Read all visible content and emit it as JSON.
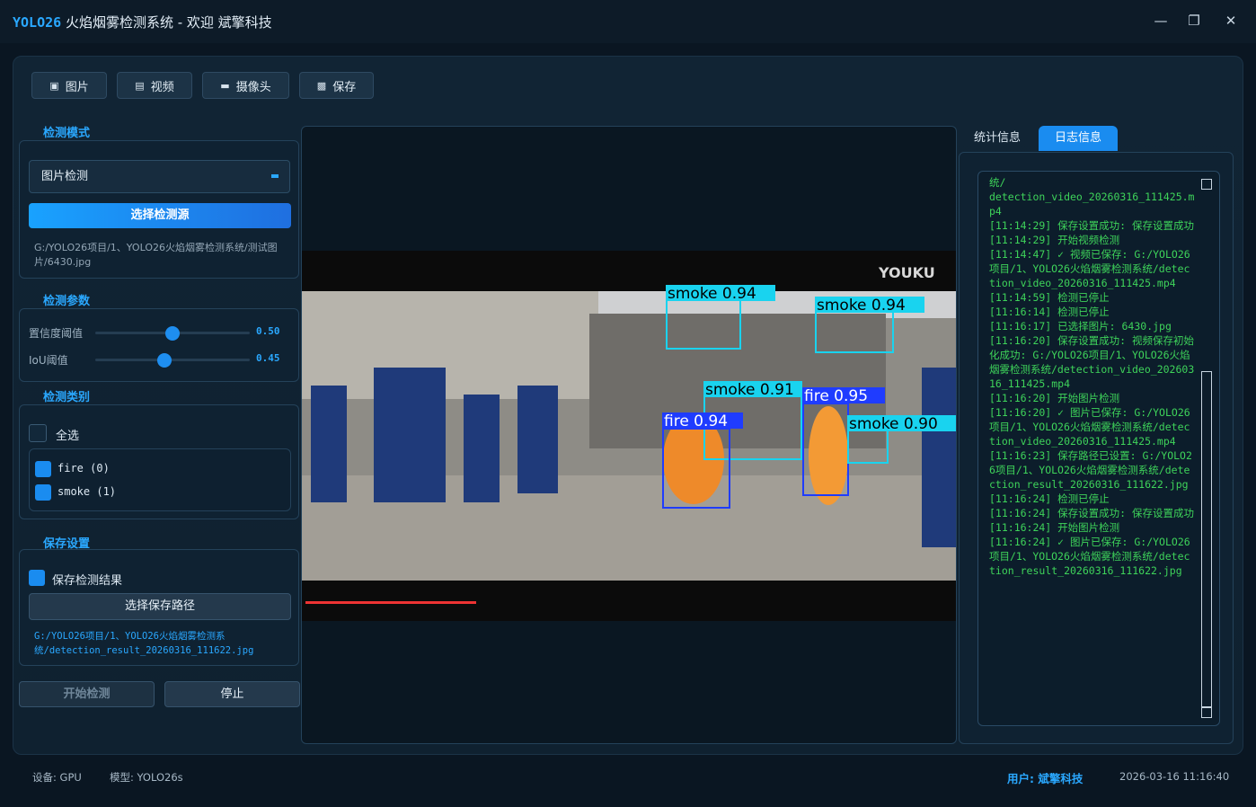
{
  "window": {
    "title_brand": "YOLO26",
    "title_rest": "火焰烟雾检测系统 - 欢迎 斌擎科技",
    "minimize": "—",
    "maximize": "❐",
    "close": "✕"
  },
  "toolbar": {
    "image_label": "图片",
    "video_label": "视频",
    "camera_label": "摄像头",
    "save_label": "保存"
  },
  "mode": {
    "section_title": "检测模式",
    "selected": "图片检测",
    "select_source_button": "选择检测源",
    "source_path": "G:/YOLO26项目/1、YOLO26火焰烟雾检测系统/测试图片/6430.jpg"
  },
  "params": {
    "section_title": "检测参数",
    "confidence_label": "置信度阈值",
    "confidence_value": "0.50",
    "confidence_fraction": 0.5,
    "iou_label": "IoU阈值",
    "iou_value": "0.45",
    "iou_fraction": 0.45
  },
  "classes": {
    "section_title": "检测类别",
    "select_all_label": "全选",
    "select_all_checked": false,
    "items": [
      {
        "label": "fire (0)",
        "checked": true
      },
      {
        "label": "smoke (1)",
        "checked": true
      }
    ]
  },
  "save": {
    "section_title": "保存设置",
    "save_result_label": "保存检测结果",
    "save_result_checked": true,
    "choose_path_button": "选择保存路径",
    "save_path": "G:/YOLO26项目/1、YOLO26火焰烟雾检测系统/detection_result_20260316_111622.jpg"
  },
  "actions": {
    "start_button": "开始检测",
    "stop_button": "停止"
  },
  "video": {
    "watermark": "YOUKU",
    "detections": [
      {
        "label": "smoke 0.94",
        "class": "smoke"
      },
      {
        "label": "smoke 0.94",
        "class": "smoke"
      },
      {
        "label": "smoke 0.91",
        "class": "smoke"
      },
      {
        "label": "fire 0.95",
        "class": "fire"
      },
      {
        "label": "fire 0.94",
        "class": "fire"
      },
      {
        "label": "smoke 0.90",
        "class": "smoke"
      }
    ]
  },
  "tabs": {
    "stats": "统计信息",
    "log": "日志信息"
  },
  "log": {
    "text": "统/\ndetection_video_20260316_111425.mp4\n[11:14:29] 保存设置成功: 保存设置成功\n[11:14:29] 开始视频检测\n[11:14:47] ✓ 视频已保存: G:/YOLO26项目/1、YOLO26火焰烟雾检测系统/detection_video_20260316_111425.mp4\n[11:14:59] 检测已停止\n[11:16:14] 检测已停止\n[11:16:17] 已选择图片: 6430.jpg\n[11:16:20] 保存设置成功: 视频保存初始化成功: G:/YOLO26项目/1、YOLO26火焰烟雾检测系统/detection_video_20260316_111425.mp4\n[11:16:20] 开始图片检测\n[11:16:20] ✓ 图片已保存: G:/YOLO26项目/1、YOLO26火焰烟雾检测系统/detection_video_20260316_111425.mp4\n[11:16:23] 保存路径已设置: G:/YOLO26项目/1、YOLO26火焰烟雾检测系统/detection_result_20260316_111622.jpg\n[11:16:24] 检测已停止\n[11:16:24] 保存设置成功: 保存设置成功\n[11:16:24] 开始图片检测\n[11:16:24] ✓ 图片已保存: G:/YOLO26项目/1、YOLO26火焰烟雾检测系统/detection_result_20260316_111622.jpg"
  },
  "status": {
    "device": "设备: GPU",
    "model": "模型: YOLO26s",
    "user": "用户: 斌擎科技",
    "datetime": "2026-03-16 11:16:40"
  },
  "colors": {
    "accent": "#2aa8ff",
    "log_green": "#3ed35a",
    "smoke_box": "#19d3ef",
    "fire_box": "#1f3cff"
  }
}
